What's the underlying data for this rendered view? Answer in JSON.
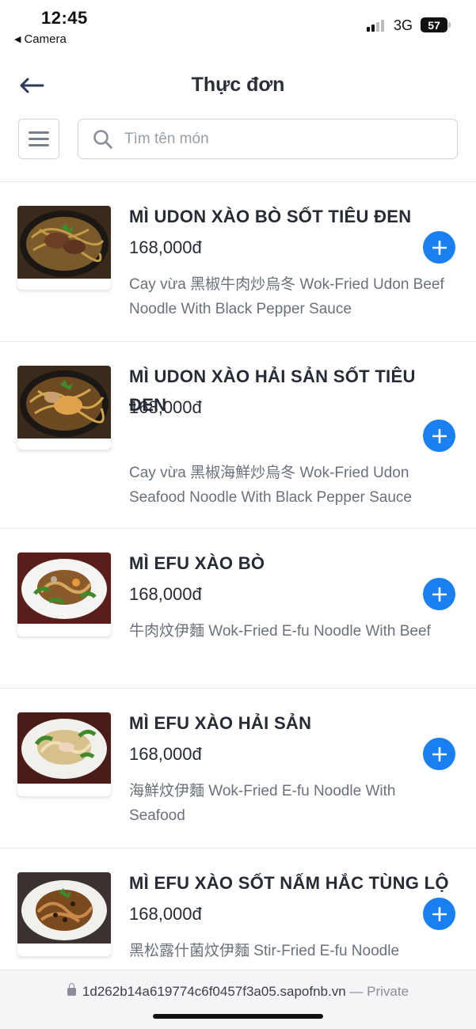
{
  "status_bar": {
    "time": "12:45",
    "back_app": "Camera",
    "network": "3G",
    "battery": "57"
  },
  "header": {
    "title": "Thực đơn",
    "back_icon": "arrow-left-icon"
  },
  "search": {
    "placeholder": "Tìm tên món",
    "value": ""
  },
  "menu_items": [
    {
      "name": "MÌ UDON XÀO BÒ SỐT TIÊU ĐEN",
      "price": "168,000đ",
      "description": "Cay vừa 黑椒牛肉炒烏冬 Wok-Fried Udon Beef Noodle With Black Pepper Sauce"
    },
    {
      "name": "MÌ UDON XÀO HẢI SẢN SỐT TIÊU ĐEN",
      "price": "168,000đ",
      "description": "Cay vừa 黑椒海鮮炒烏冬 Wok-Fried Udon Seafood Noodle With Black Pepper Sauce"
    },
    {
      "name": "MÌ EFU XÀO BÒ",
      "price": "168,000đ",
      "description": "牛肉炆伊麵 Wok-Fried E-fu Noodle With Beef"
    },
    {
      "name": "MÌ EFU XÀO HẢI SẢN",
      "price": "168,000đ",
      "description": "海鮮炆伊麵 Wok-Fried E-fu Noodle With Seafood"
    },
    {
      "name": "MÌ EFU XÀO SỐT NẤM HẮC TÙNG LỘ",
      "price": "168,000đ",
      "description": "黑松露什菌炆伊麵 Stir-Fried E-fu Noodle"
    }
  ],
  "url_bar": {
    "url": "1d262b14a619774c6f0457f3a05.sapofnb.vn",
    "separator": "—",
    "mode": "Private"
  },
  "colors": {
    "accent": "#1a7ff0",
    "text": "#262b35",
    "muted": "#6b717b"
  }
}
